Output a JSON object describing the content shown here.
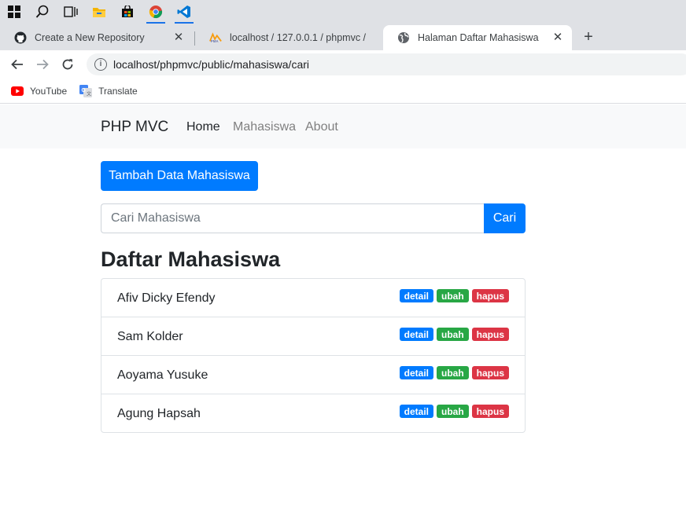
{
  "taskbar": {
    "icons": [
      "windows-start-icon",
      "search-icon",
      "task-view-icon",
      "file-explorer-icon",
      "store-icon",
      "chrome-icon",
      "vscode-icon"
    ]
  },
  "tabs": [
    {
      "title": "Create a New Repository",
      "icon": "github-icon",
      "active": false
    },
    {
      "title": "localhost / 127.0.0.1 / phpmvc / ",
      "icon": "phpmyadmin-icon",
      "active": false
    },
    {
      "title": "Halaman Daftar Mahasiswa",
      "icon": "globe-icon",
      "active": true
    }
  ],
  "address": {
    "url": "localhost/phpmvc/public/mahasiswa/cari"
  },
  "bookmarks": [
    {
      "label": "YouTube",
      "icon": "youtube-icon"
    },
    {
      "label": "Translate",
      "icon": "translate-icon"
    }
  ],
  "navbar": {
    "brand": "PHP MVC",
    "links": [
      "Home",
      "Mahasiswa",
      "About"
    ]
  },
  "main": {
    "add_button": "Tambah Data Mahasiswa",
    "search_placeholder": "Cari Mahasiswa",
    "search_button": "Cari",
    "heading": "Daftar Mahasiswa",
    "badge_labels": {
      "detail": "detail",
      "edit": "ubah",
      "delete": "hapus"
    },
    "students": [
      {
        "name": "Afiv Dicky Efendy"
      },
      {
        "name": "Sam Kolder"
      },
      {
        "name": "Aoyama Yusuke"
      },
      {
        "name": "Agung Hapsah"
      }
    ]
  },
  "colors": {
    "primary": "#007bff",
    "success": "#28a745",
    "danger": "#dc3545"
  }
}
